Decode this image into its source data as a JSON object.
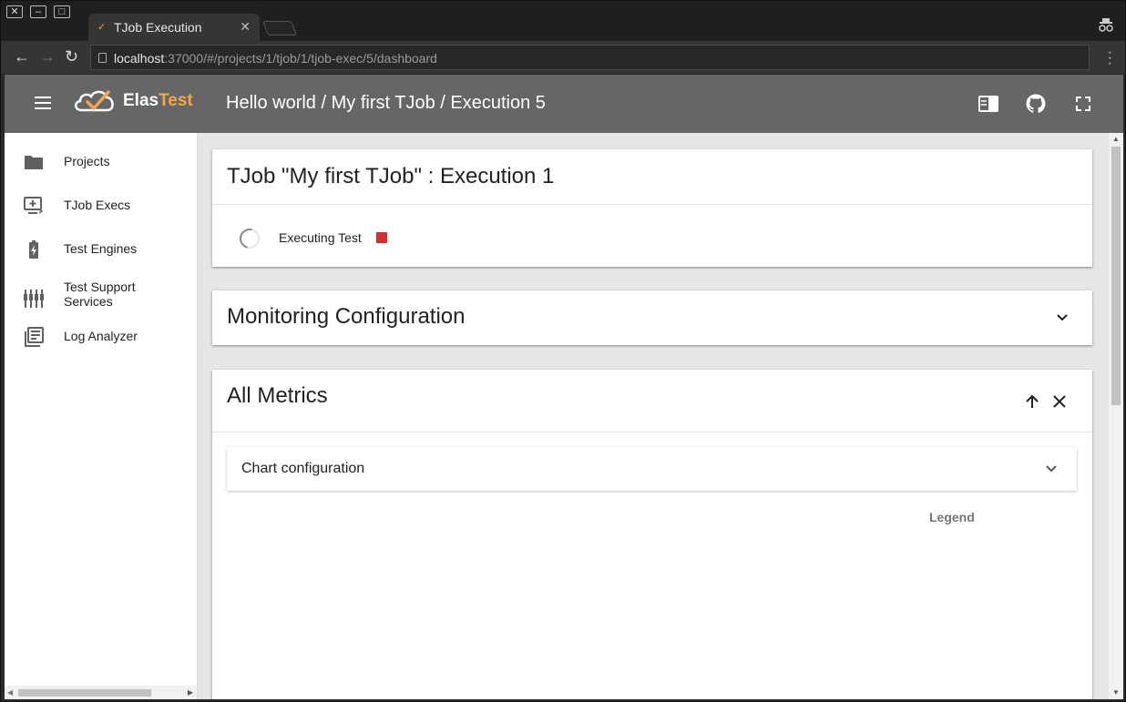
{
  "browser": {
    "tab_title": "TJob Execution",
    "tab_close": "✕",
    "url_host": "localhost",
    "url_rest": ":37000/#/projects/1/tjob/1/tjob-exec/5/dashboard"
  },
  "header": {
    "logo_part1": "Elas",
    "logo_part2": "Test",
    "title": "Hello world / My first TJob / Execution 5"
  },
  "sidebar": {
    "items": [
      {
        "label": "Projects"
      },
      {
        "label": "TJob Execs"
      },
      {
        "label": "Test Engines"
      },
      {
        "label": "Test Support Services"
      },
      {
        "label": "Log Analyzer"
      }
    ]
  },
  "main": {
    "execution_card": {
      "title": "TJob \"My first TJob\" : Execution 1",
      "status": "Executing Test"
    },
    "monitoring_card": {
      "title": "Monitoring Configuration"
    },
    "metrics_card": {
      "title": "All Metrics",
      "chart_config_label": "Chart configuration",
      "legend_label": "Legend"
    }
  },
  "colors": {
    "appbar": "#666666",
    "accent": "#f4a64a",
    "stop": "#d32f2f"
  }
}
